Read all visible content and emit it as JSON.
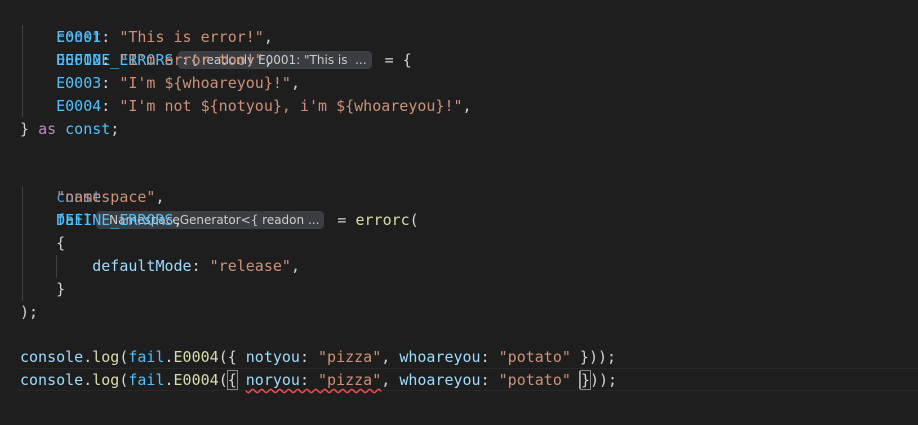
{
  "code": {
    "l1": {
      "kw": "const",
      "name": "DEFINE_ERRORS",
      "hint": ": { readonly E0001: \"This is  ...",
      "rest": " = {"
    },
    "l2": {
      "key": "E0001",
      "colon": ": ",
      "val": "\"This is error!\"",
      "end": ","
    },
    "l3": {
      "key": "E0002",
      "colon": ": ",
      "val": "\"I'm error too!\"",
      "end": ","
    },
    "l4": {
      "key": "E0003",
      "colon": ": ",
      "val": "\"I'm ${whoareyou}!\"",
      "end": ","
    },
    "l5": {
      "key": "E0004",
      "colon": ": ",
      "val": "\"I'm not ${notyou}, i'm ${whoareyou}!\"",
      "end": ","
    },
    "l6": {
      "brace": "} ",
      "as": "as",
      "const": " const",
      "end": ";"
    },
    "l8": {
      "kw": "const",
      "name": "fail",
      "hint": ": NamespaceGenerator<{ readon ...",
      "eq": " = ",
      "fn": "errorc",
      "paren": "("
    },
    "l9": {
      "str": "\"namespace\"",
      "end": ","
    },
    "l10": {
      "name": "DEFINE_ERRORS",
      "end": ","
    },
    "l11": {
      "brace": "{"
    },
    "l12": {
      "key": "defaultMode",
      "colon": ": ",
      "val": "\"release\"",
      "end": ","
    },
    "l13": {
      "brace": "}"
    },
    "l14": {
      "text": ");"
    },
    "l16": {
      "obj": "console",
      "dot1": ".",
      "fn": "log",
      "p1": "(",
      "var": "fail",
      "dot2": ".",
      "method": "E0004",
      "p2": "({ ",
      "k1": "notyou",
      "c1": ": ",
      "v1": "\"pizza\"",
      "sep": ", ",
      "k2": "whoareyou",
      "c2": ": ",
      "v2": "\"potato\"",
      "end": " }));"
    },
    "l17": {
      "obj": "console",
      "dot1": ".",
      "fn": "log",
      "p1": "(",
      "var": "fail",
      "dot2": ".",
      "method": "E0004",
      "p2": "(",
      "ob": "{",
      "sp": " ",
      "k1": "noryou",
      "c1": ": ",
      "v1": "\"pizza\"",
      "sep": ", ",
      "k2": "whoareyou",
      "c2": ": ",
      "v2": "\"potato\"",
      "sp2": " ",
      "cb": "}",
      "end": "));"
    }
  }
}
